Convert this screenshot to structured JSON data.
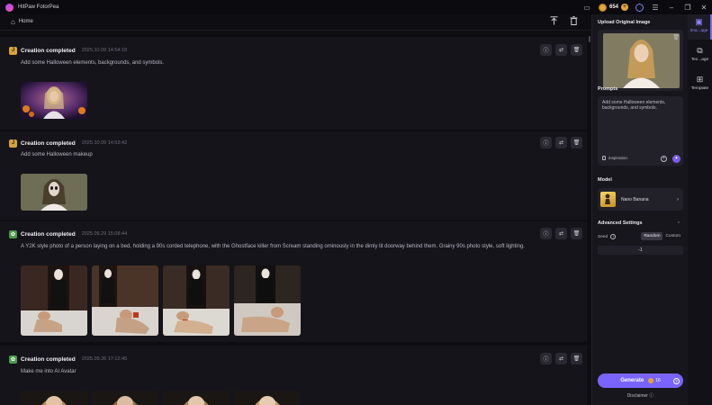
{
  "app": {
    "title": "HitPaw FotorPea",
    "credits": "654",
    "colors": {
      "accent": "#7a63ff",
      "coin": "#e3a43a",
      "background": "#0e0d12"
    }
  },
  "titlebar_icons": [
    "chat-icon",
    "coin-icon",
    "plus-icon",
    "user-icon",
    "menu-icon",
    "minimize-icon",
    "maximize-icon",
    "close-icon"
  ],
  "nav": {
    "home_label": "Home"
  },
  "feed": {
    "cards": [
      {
        "title": "Creation completed",
        "time": "2025.10.09 14:54:18",
        "prompt": "Add some Halloween elements, backgrounds, and symbols.",
        "badge": "J",
        "thumb_count": 1
      },
      {
        "title": "Creation completed",
        "time": "2025.10.09 14:53:42",
        "prompt": "Add some Halloween makeup",
        "badge": "J",
        "thumb_count": 1
      },
      {
        "title": "Creation completed",
        "time": "2025.09.29 15:08:44",
        "prompt": "A Y2K style photo of a person laying on a bed, holding a 90s corded telephone, with the Ghostface killer from Scream standing ominously in the dimly lit doorway behind them. Grainy 90s photo style, soft lighting.",
        "badge": "",
        "thumb_count": 4
      },
      {
        "title": "Creation completed",
        "time": "2025.09.26 17:12:46",
        "prompt": "Make me into AI Avatar",
        "badge": "",
        "thumb_count": 4
      }
    ]
  },
  "panel": {
    "upload_label": "Upload Original Image",
    "prompts_label": "Prompts",
    "prompt_text": "Add some Halloween elements, backgrounds, and symbols.",
    "inspiration_label": "inspiration",
    "model_label": "Model",
    "model_name": "Nano Banana",
    "advanced_label": "Advanced Settings",
    "seed_label": "Seed",
    "seed_random": "Random",
    "seed_custom": "Custom",
    "seed_value": "-1",
    "generate_label": "Generate",
    "generate_cost": "16",
    "disclaimer": "Disclaimer"
  },
  "rail": {
    "items": [
      {
        "label": "Ima...age",
        "icon": "image-icon",
        "active": true
      },
      {
        "label": "Tex...age",
        "icon": "text-to-image-icon",
        "active": false
      },
      {
        "label": "Template",
        "icon": "template-icon",
        "active": false
      }
    ]
  }
}
